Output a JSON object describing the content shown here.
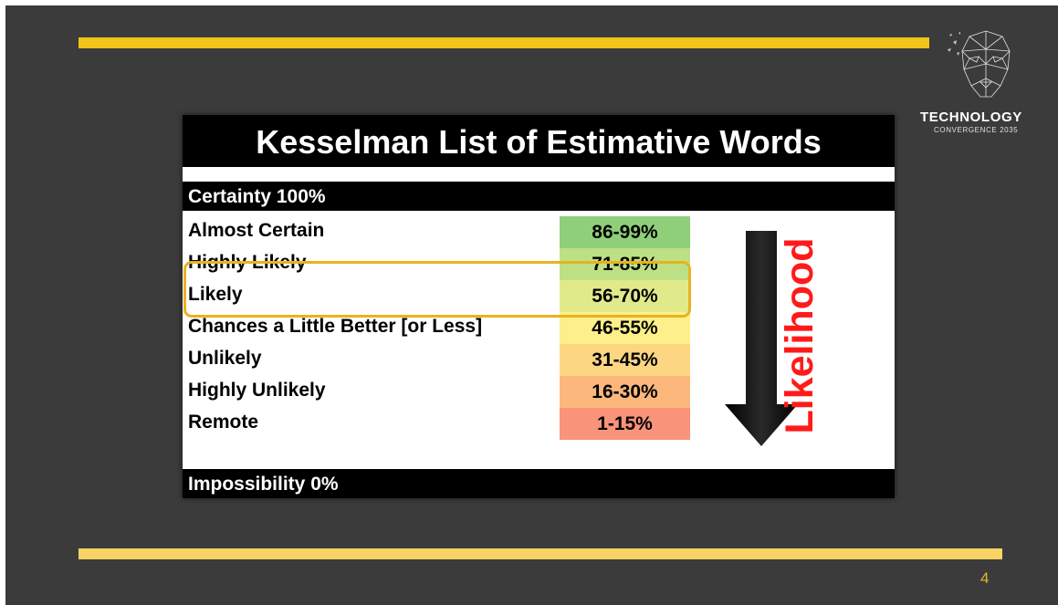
{
  "slide": {
    "page_number": "4",
    "logo": {
      "title": "TECHNOLOGY",
      "subtitle": "CONVERGENCE 2035"
    },
    "colors": {
      "background": "#3b3b3b",
      "accent_bar": "#f2c318",
      "highlight": "#e9b21f",
      "likelihood_text": "#ff1a1a"
    }
  },
  "table": {
    "title": "Kesselman List of Estimative Words",
    "top_band": "Certainty 100%",
    "bottom_band": "Impossibility 0%",
    "side_label": "Likelihood",
    "rows": [
      {
        "label": "Almost Certain",
        "range": "86-99%",
        "color": "#8fcf7a"
      },
      {
        "label": "Highly Likely",
        "range": "71-85%",
        "color": "#bde085"
      },
      {
        "label": "Likely",
        "range": "56-70%",
        "color": "#e0ea8b"
      },
      {
        "label": "Chances a Little Better [or Less]",
        "range": "46-55%",
        "color": "#fdf08a"
      },
      {
        "label": "Unlikely",
        "range": "31-45%",
        "color": "#fdd684"
      },
      {
        "label": "Highly Unlikely",
        "range": "16-30%",
        "color": "#fcb77c"
      },
      {
        "label": "Remote",
        "range": "1-15%",
        "color": "#f9937a"
      }
    ],
    "highlighted_rows": [
      "Highly Likely",
      "Likely"
    ]
  }
}
